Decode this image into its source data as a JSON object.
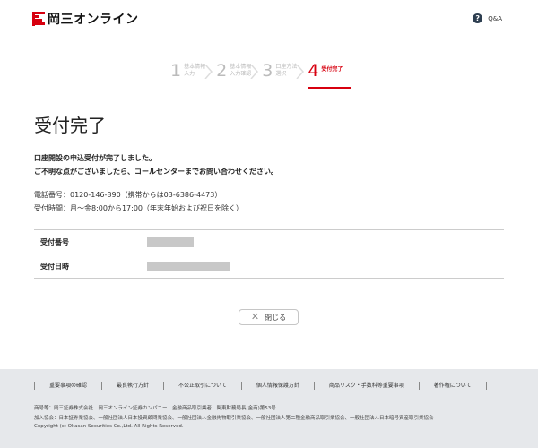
{
  "header": {
    "logo_text": "岡三オンライン",
    "qa_icon_glyph": "?",
    "qa_label": "Q&A"
  },
  "steps": [
    {
      "num": "1",
      "label": "基本情報\n入力",
      "state": "done"
    },
    {
      "num": "2",
      "label": "基本情報\n入力確認",
      "state": "done"
    },
    {
      "num": "3",
      "label": "口座方法\n選択",
      "state": "done"
    },
    {
      "num": "4",
      "label": "受付完了",
      "state": "current"
    }
  ],
  "main": {
    "title": "受付完了",
    "message_line1": "口座開設の申込受付が完了しました。",
    "message_line2": "ご不明な点がございましたら、コールセンターまでお問い合わせください。",
    "tel": "電話番号：0120-146-890（携帯からは03-6386-4473）",
    "hours": "受付時間：月～金8:00から17:00（年末年始および祝日を除く）",
    "table": [
      {
        "label": "受付番号"
      },
      {
        "label": "受付日時"
      }
    ],
    "close_label": "閉じる",
    "close_icon": "close-icon"
  },
  "footer": {
    "links": [
      "重要事項の確認",
      "最良執行方針",
      "不公正取引について",
      "個人情報保護方針",
      "商品リスク・手数料等重要事項",
      "著作権について"
    ],
    "company": "商号等：岡三証券株式会社　岡三オンライン証券カンパニー　金融商品取引業者　関東財務局長(金商)第53号",
    "associations": "加入協会：日本証券業協会、一般社団法人日本投資顧問業協会、一般社団法人金融先物取引業協会、一般社団法人第二種金融商品取引業協会、一般社団法人日本暗号資産取引業協会",
    "copyright": "Copyright (c) Okasan Securities Co.,Ltd. All Rights Reserved."
  },
  "colors": {
    "brand_red": "#d7000f",
    "footer_bg": "#e6e8eb"
  }
}
